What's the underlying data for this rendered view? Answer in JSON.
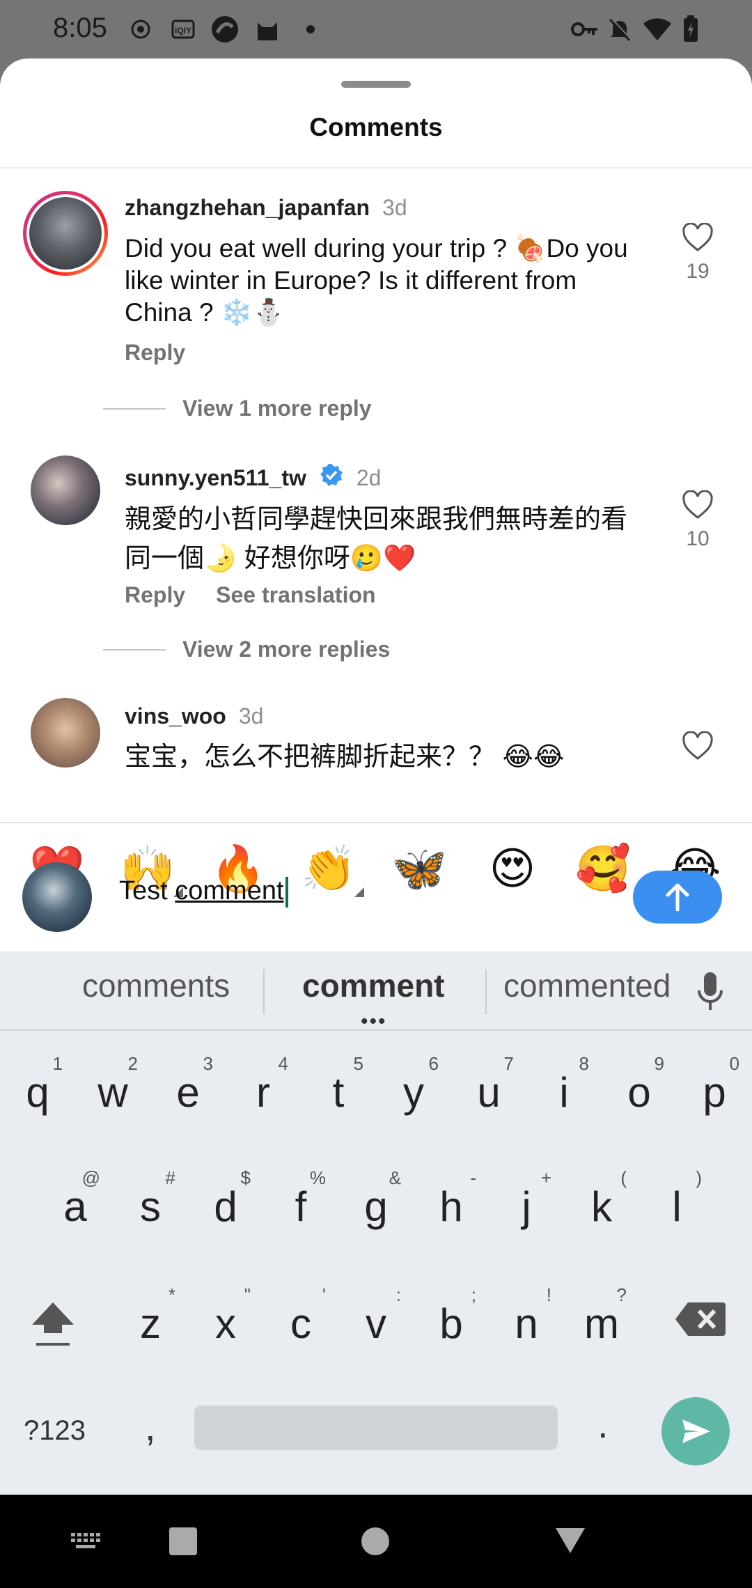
{
  "status_bar": {
    "time": "8:05",
    "icons": [
      "record-icon",
      "iqiyi-icon",
      "browser-icon",
      "cat-icon",
      "dot-icon",
      "vpn-key-icon",
      "bell-off-icon",
      "wifi-icon",
      "battery-icon"
    ]
  },
  "sheet": {
    "title": "Comments"
  },
  "comments": [
    {
      "username": "zhangzhehan_japanfan",
      "age": "3d",
      "text": "Did you eat well during your trip ? 🍖Do you like winter in Europe? Is it different from China ? ❄️⛄",
      "reply_label": "Reply",
      "likes": "19",
      "view_replies": "View 1 more reply"
    },
    {
      "username": "sunny.yen511_tw",
      "verified": true,
      "age": "2d",
      "text": "親愛的小哲同學趕快回來跟我們無時差的看同一個🌛 好想你呀🥲❤️",
      "reply_label": "Reply",
      "translate_label": "See translation",
      "likes": "10",
      "view_replies": "View 2 more replies"
    },
    {
      "username": "vins_woo",
      "age": "3d",
      "text": "宝宝，怎么不把裤脚折起来？？ 😂😂"
    }
  ],
  "emoji_bar": [
    "❤️",
    "🙌",
    "🔥",
    "👏",
    "🦋",
    "😍",
    "🥰",
    "😂"
  ],
  "composer": {
    "text_prefix": "Test ",
    "text_underlined": "comment"
  },
  "keyboard": {
    "suggestions": [
      "comments",
      "comment",
      "commented"
    ],
    "row1": [
      {
        "k": "q",
        "h": "1"
      },
      {
        "k": "w",
        "h": "2"
      },
      {
        "k": "e",
        "h": "3"
      },
      {
        "k": "r",
        "h": "4"
      },
      {
        "k": "t",
        "h": "5"
      },
      {
        "k": "y",
        "h": "6"
      },
      {
        "k": "u",
        "h": "7"
      },
      {
        "k": "i",
        "h": "8"
      },
      {
        "k": "o",
        "h": "9"
      },
      {
        "k": "p",
        "h": "0"
      }
    ],
    "row2": [
      {
        "k": "a",
        "h": "@"
      },
      {
        "k": "s",
        "h": "#"
      },
      {
        "k": "d",
        "h": "$"
      },
      {
        "k": "f",
        "h": "%"
      },
      {
        "k": "g",
        "h": "&"
      },
      {
        "k": "h",
        "h": "-"
      },
      {
        "k": "j",
        "h": "+"
      },
      {
        "k": "k",
        "h": "("
      },
      {
        "k": "l",
        "h": ")"
      }
    ],
    "row3": [
      {
        "k": "z",
        "h": "*"
      },
      {
        "k": "x",
        "h": "\""
      },
      {
        "k": "c",
        "h": "'"
      },
      {
        "k": "v",
        "h": ":"
      },
      {
        "k": "b",
        "h": ";"
      },
      {
        "k": "n",
        "h": "!"
      },
      {
        "k": "m",
        "h": "?"
      }
    ],
    "symbols_label": "?123",
    "comma_label": ",",
    "period_label": "."
  }
}
